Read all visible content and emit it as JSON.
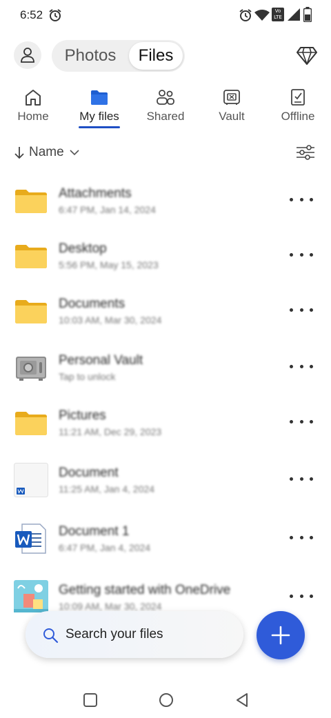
{
  "status_bar": {
    "time": "6:52",
    "icons": [
      "alarm-icon",
      "wifi-icon",
      "volte-icon",
      "signal-icon",
      "battery-icon"
    ],
    "volte_text": "Vo LTE"
  },
  "header": {
    "segments": {
      "photos": "Photos",
      "files": "Files",
      "selected": "Files"
    },
    "icons": [
      "profile-icon",
      "premium-diamond-icon"
    ]
  },
  "tabs": [
    {
      "label": "Home",
      "icon": "home-icon",
      "active": false
    },
    {
      "label": "My files",
      "icon": "folder-icon",
      "active": true
    },
    {
      "label": "Shared",
      "icon": "people-icon",
      "active": false
    },
    {
      "label": "Vault",
      "icon": "vault-icon",
      "active": false
    },
    {
      "label": "Offline",
      "icon": "offline-icon",
      "active": false
    }
  ],
  "sort": {
    "label": "Name",
    "icons": [
      "arrow-down-icon",
      "chevron-down-icon",
      "filter-sliders-icon"
    ]
  },
  "files": [
    {
      "name": "Attachments",
      "meta": "6:47 PM, Jan 14, 2024",
      "type": "folder"
    },
    {
      "name": "Desktop",
      "meta": "5:56 PM, May 15, 2023",
      "type": "folder"
    },
    {
      "name": "Documents",
      "meta": "10:03 AM, Mar 30, 2024",
      "type": "folder"
    },
    {
      "name": "Personal Vault",
      "meta": "Tap to unlock",
      "type": "vault"
    },
    {
      "name": "Pictures",
      "meta": "11:21 AM, Dec 29, 2023",
      "type": "folder"
    },
    {
      "name": "Document",
      "meta": "11:25 AM, Jan 4, 2024",
      "type": "word-preview"
    },
    {
      "name": "Document 1",
      "meta": "6:47 PM, Jan 4, 2024",
      "type": "word"
    },
    {
      "name": "Getting started with OneDrive",
      "meta": "10:09 AM, Mar 30, 2024",
      "type": "pdf-preview"
    }
  ],
  "search": {
    "placeholder": "Search your files"
  },
  "fab": {
    "icon": "plus-icon"
  },
  "nav": [
    "recents-square-icon",
    "home-circle-icon",
    "back-triangle-icon"
  ],
  "colors": {
    "accent": "#2f5bd9",
    "tab_underline": "#1f4fc4",
    "folder": "#f7c948",
    "word_blue": "#185abd"
  }
}
